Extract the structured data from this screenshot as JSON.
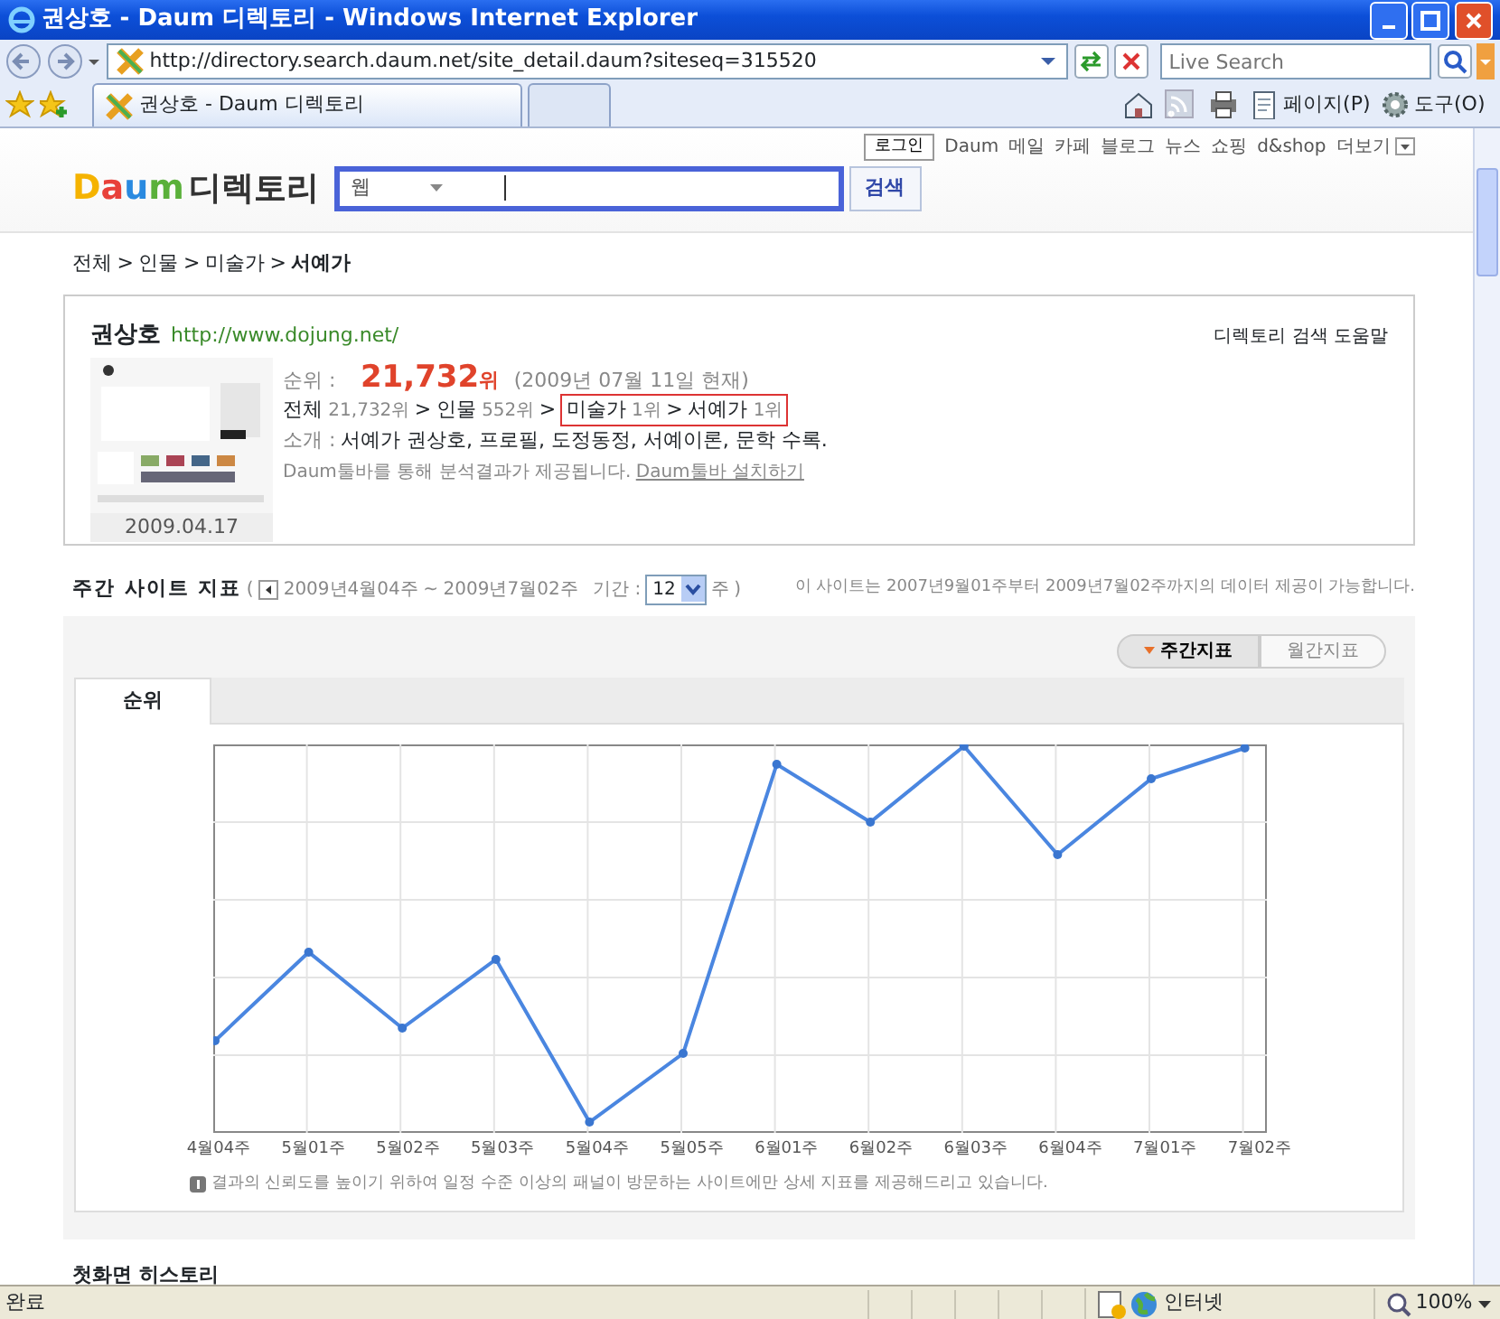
{
  "window": {
    "title": "권상호 - Daum 디렉토리 - Windows Internet Explorer"
  },
  "address_bar": {
    "url": "http://directory.search.daum.net/site_detail.daum?siteseq=315520"
  },
  "search_box": {
    "placeholder": "Live Search"
  },
  "tabs": [
    {
      "label": "권상호 - Daum 디렉토리",
      "selected": true
    }
  ],
  "toolbar": {
    "page_menu": "페이지(P)",
    "tools_menu": "도구(O)"
  },
  "page": {
    "login": "로그인",
    "nav_links": [
      "Daum",
      "메일",
      "카페",
      "블로그",
      "뉴스",
      "쇼핑",
      "d&shop",
      "더보기"
    ],
    "logo": {
      "brand": "Daum",
      "service": "디렉토리"
    },
    "search": {
      "category": "웹",
      "button": "검색"
    },
    "breadcrumb": {
      "separator": ">",
      "items": [
        "전체",
        "인물",
        "미술가",
        "서예가"
      ]
    },
    "site": {
      "name": "권상호",
      "url": "http://www.dojung.net/",
      "help_link": "디렉토리 검색 도움말",
      "thumbnail_date": "2009.04.17",
      "rank_label": "순위 :",
      "rank": "21,732",
      "rank_unit": "위",
      "rank_date": "(2009년 07월 11일 현재)",
      "categories": [
        {
          "name": "전체",
          "rank": "21,732위",
          "highlighted": false
        },
        {
          "name": "인물",
          "rank": "552위",
          "highlighted": false
        },
        {
          "name": "미술가",
          "rank": "1위",
          "highlighted": true
        },
        {
          "name": "서예가",
          "rank": "1위",
          "highlighted": true
        }
      ],
      "intro_label": "소개 :",
      "intro": "서예가 권상호, 프로필, 도정동정, 서예이론, 문학 수록.",
      "toolbar_note": "Daum툴바를 통해 분석결과가 제공됩니다.",
      "toolbar_link": "Daum툴바 설치하기"
    },
    "weekly": {
      "title": "주간 사이트 지표",
      "open_paren": "(",
      "period_start": "2009년4월04주",
      "tilde": "~",
      "period_end": "2009년7월02주",
      "period_label": "기간 :",
      "period_value": "12",
      "period_unit": "주",
      "close_paren": ")",
      "availability": "이 사이트는 2007년9월01주부터 2009년7월02주까지의 데이터 제공이 가능합니다.",
      "toggles": [
        {
          "label": "주간지표",
          "selected": true
        },
        {
          "label": "월간지표",
          "selected": false
        }
      ],
      "chart_tabs": [
        {
          "label": "순위",
          "selected": true
        }
      ],
      "x_labels": [
        "4월04주",
        "5월01주",
        "5월02주",
        "5월03주",
        "5월04주",
        "5월05주",
        "6월01주",
        "6월02주",
        "6월03주",
        "6월04주",
        "7월01주",
        "7월02주"
      ],
      "note": "결과의 신뢰도를 높이기 위하여 일정 수준 이상의 패널이 방문하는 사이트에만 상세 지표를 제공해드리고 있습니다."
    },
    "next_section": "첫화면 히스토리"
  },
  "status_bar": {
    "text": "완료",
    "zone": "인터넷",
    "zoom": "100%"
  }
}
